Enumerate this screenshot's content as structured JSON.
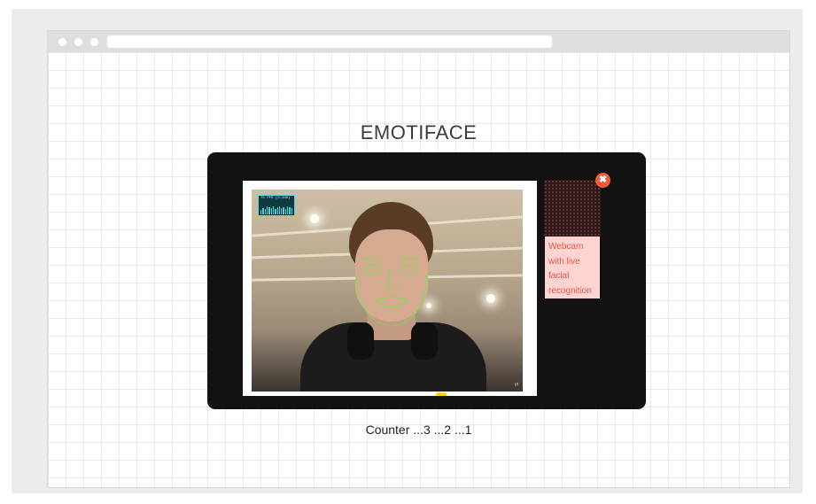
{
  "app": {
    "title": "EMOTIFACE"
  },
  "webcam": {
    "fps_text": "75 FPS (0-100)",
    "fps_history": [
      0.5,
      0.7,
      0.6,
      0.9,
      0.8,
      0.75,
      0.9,
      0.6,
      0.8,
      0.95,
      0.7,
      0.85,
      0.65,
      0.9,
      0.8,
      0.7
    ],
    "label": "Webcam with live facial recognition",
    "watermark": "f/f"
  },
  "close_icon": "close-icon",
  "colors": {
    "modal_bg": "#121212",
    "label_bg": "#ffd3cf",
    "label_text": "#e0584f",
    "close_bg": "#f05a40",
    "tracking": "#6ee64a",
    "fps_accent": "#3fd2dc"
  },
  "counter": {
    "text": "Counter ...3 ...2 ...1"
  }
}
